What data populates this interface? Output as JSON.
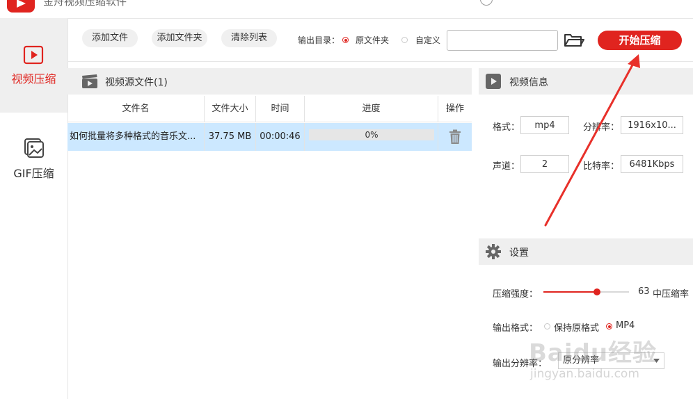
{
  "app": {
    "title": "金舟视频压缩软件",
    "accent_color": "#e0241f"
  },
  "nav": [
    {
      "label": "视频压缩",
      "icon": "video-play-icon",
      "active": true
    },
    {
      "label": "GIF压缩",
      "icon": "image-icon",
      "active": false
    }
  ],
  "toolbar": {
    "add_file": "添加文件",
    "add_folder": "添加文件夹",
    "clear_list": "清除列表",
    "output_dir_label": "输出目录：",
    "output_options": [
      "原文件夹",
      "自定义"
    ],
    "output_selected": "原文件夹",
    "custom_path": "",
    "start_button": "开始压缩"
  },
  "file_list": {
    "header": "视频源文件(1)",
    "columns": [
      "文件名",
      "文件大小",
      "时间",
      "进度",
      "操作"
    ],
    "rows": [
      {
        "name": "如何批量将多种格式的音乐文...",
        "size": "37.75 MB",
        "duration": "00:00:46",
        "progress": "0%"
      }
    ]
  },
  "video_info": {
    "header": "视频信息",
    "format_label": "格式：",
    "format_value": "mp4",
    "resolution_label": "分辨率：",
    "resolution_value": "1916x10...",
    "channels_label": "声道：",
    "channels_value": "2",
    "bitrate_label": "比特率：",
    "bitrate_value": "6481Kbps"
  },
  "settings": {
    "header": "设置",
    "strength_label": "压缩强度：",
    "strength_value": "63",
    "strength_text": "中压缩率",
    "output_format_label": "输出格式：",
    "format_options": [
      "保持原格式",
      "MP4"
    ],
    "format_selected": "MP4",
    "resolution_label": "输出分辨率：",
    "resolution_value": "原分辨率"
  },
  "watermark": {
    "line1": "Baidu经验",
    "line2": "jingyan.baidu.com"
  }
}
